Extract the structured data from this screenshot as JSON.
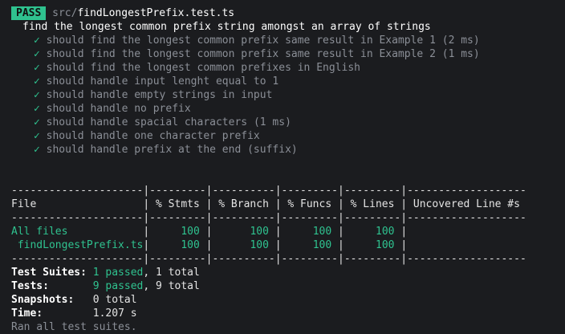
{
  "header": {
    "badge": "PASS",
    "path_dir": "src/",
    "path_file": "findLongestPrefix.test.ts"
  },
  "suite": {
    "title": "find the longest common prefix string amongst an array of strings",
    "check_glyph": "✓",
    "tests": [
      {
        "name": "should find the longest common prefix same result in Example 1",
        "time": "(2 ms)"
      },
      {
        "name": "should find the longest common prefix same result in Example 2",
        "time": "(1 ms)"
      },
      {
        "name": "should find the longest common prefixes in English",
        "time": ""
      },
      {
        "name": "should handle input lenght equal to 1",
        "time": ""
      },
      {
        "name": "should handle empty strings in input",
        "time": ""
      },
      {
        "name": "should handle no prefix",
        "time": ""
      },
      {
        "name": "should handle spacial characters",
        "time": "(1 ms)"
      },
      {
        "name": "should handle one character prefix",
        "time": ""
      },
      {
        "name": "should handle prefix at the end (suffix)",
        "time": ""
      }
    ]
  },
  "coverage": {
    "separator": "---------------------|---------|----------|---------|---------|-------------------",
    "header": "File                 | % Stmts | % Branch | % Funcs | % Lines | Uncovered Line #s",
    "rows": [
      {
        "file": "All files",
        "stmts": "100",
        "branch": "100",
        "funcs": "100",
        "lines": "100",
        "uncovered": ""
      },
      {
        "file": " findLongestPrefix.ts",
        "stmts": "100",
        "branch": "100",
        "funcs": "100",
        "lines": "100",
        "uncovered": ""
      }
    ]
  },
  "summary": {
    "suites_label": "Test Suites:",
    "suites_passed": "1 passed",
    "suites_total": ", 1 total",
    "tests_label": "Tests:",
    "tests_passed": "9 passed",
    "tests_total": ", 9 total",
    "snapshots_label": "Snapshots:",
    "snapshots_value": "0 total",
    "time_label": "Time:",
    "time_value": "1.207 s",
    "ran_all": "Ran all test suites."
  },
  "colors": {
    "background": "#1b1c1f",
    "pass_green": "#2fc28f",
    "dim_gray": "#8b8f97"
  }
}
